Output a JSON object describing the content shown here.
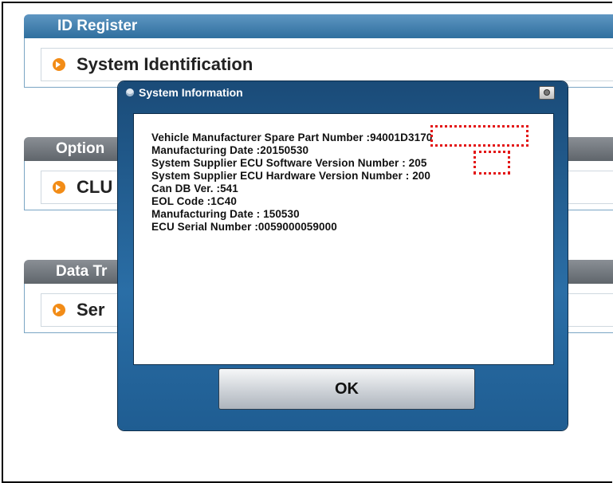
{
  "sections": {
    "id_register": {
      "header": "ID Register",
      "item": "System Identification"
    },
    "option": {
      "header": "Option",
      "item": "CLU"
    },
    "data_transfer": {
      "header": "Data Tr",
      "item": "Ser"
    }
  },
  "dialog": {
    "title": "System Information",
    "lines": [
      "Vehicle Manufacturer Spare Part Number :94001D3170",
      "Manufacturing Date :20150530",
      "System Supplier ECU Software Version Number : 205",
      "System Supplier ECU Hardware Version Number : 200",
      "Can DB Ver. :541",
      "EOL Code :1C40",
      "Manufacturing Date : 150530",
      "ECU Serial Number :0059000059000"
    ],
    "ok_label": "OK",
    "highlight_color": "#e31414"
  }
}
